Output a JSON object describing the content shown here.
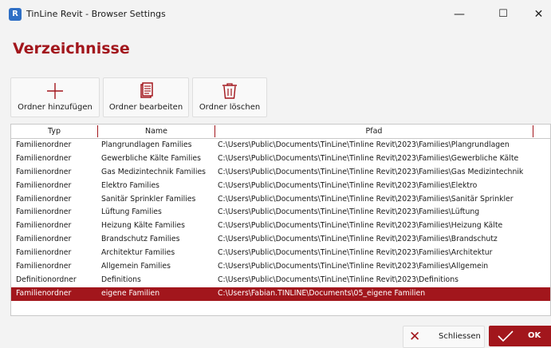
{
  "window": {
    "app_icon": "R",
    "title": "TinLine Revit - Browser Settings",
    "minimize": "—",
    "maximize": "☐",
    "close": "✕"
  },
  "heading": "Verzeichnisse",
  "toolbar": {
    "add_label": "Ordner hinzufügen",
    "edit_label": "Ordner bearbeiten",
    "delete_label": "Ordner löschen"
  },
  "table": {
    "columns": [
      "Typ",
      "Name",
      "Pfad"
    ],
    "rows": [
      {
        "typ": "Familienordner",
        "name": "Plangrundlagen Families",
        "pfad": "C:\\Users\\Public\\Documents\\TinLine\\Tinline Revit\\2023\\Families\\Plangrundlagen"
      },
      {
        "typ": "Familienordner",
        "name": "Gewerbliche Kälte Families",
        "pfad": "C:\\Users\\Public\\Documents\\TinLine\\Tinline Revit\\2023\\Families\\Gewerbliche Kälte"
      },
      {
        "typ": "Familienordner",
        "name": "Gas Medizintechnik Families",
        "pfad": "C:\\Users\\Public\\Documents\\TinLine\\Tinline Revit\\2023\\Families\\Gas Medizintechnik"
      },
      {
        "typ": "Familienordner",
        "name": "Elektro Families",
        "pfad": "C:\\Users\\Public\\Documents\\TinLine\\Tinline Revit\\2023\\Families\\Elektro"
      },
      {
        "typ": "Familienordner",
        "name": "Sanitär Sprinkler Families",
        "pfad": "C:\\Users\\Public\\Documents\\TinLine\\Tinline Revit\\2023\\Families\\Sanitär Sprinkler"
      },
      {
        "typ": "Familienordner",
        "name": "Lüftung Families",
        "pfad": "C:\\Users\\Public\\Documents\\TinLine\\Tinline Revit\\2023\\Families\\Lüftung"
      },
      {
        "typ": "Familienordner",
        "name": "Heizung Kälte Families",
        "pfad": "C:\\Users\\Public\\Documents\\TinLine\\Tinline Revit\\2023\\Families\\Heizung Kälte"
      },
      {
        "typ": "Familienordner",
        "name": "Brandschutz Families",
        "pfad": "C:\\Users\\Public\\Documents\\TinLine\\Tinline Revit\\2023\\Families\\Brandschutz"
      },
      {
        "typ": "Familienordner",
        "name": "Architektur Families",
        "pfad": "C:\\Users\\Public\\Documents\\TinLine\\Tinline Revit\\2023\\Families\\Architektur"
      },
      {
        "typ": "Familienordner",
        "name": "Allgemein Families",
        "pfad": "C:\\Users\\Public\\Documents\\TinLine\\Tinline Revit\\2023\\Families\\Allgemein"
      },
      {
        "typ": "Definitionordner",
        "name": "Definitions",
        "pfad": "C:\\Users\\Public\\Documents\\TinLine\\Tinline Revit\\2023\\Definitions"
      },
      {
        "typ": "Familienordner",
        "name": "eigene Familien",
        "pfad": "C:\\Users\\Fabian.TINLINE\\Documents\\05_eigene Familien",
        "selected": true
      }
    ]
  },
  "footer": {
    "cancel_label": "Schliessen",
    "ok_label": "OK"
  },
  "colors": {
    "accent": "#a2161c",
    "background": "#f3f3f3",
    "app_icon": "#2f6fc5"
  },
  "icons": {
    "add": "plus-icon",
    "edit": "document-edit-icon",
    "delete": "trash-icon",
    "cancel": "close-icon",
    "ok": "checkmark-icon"
  }
}
